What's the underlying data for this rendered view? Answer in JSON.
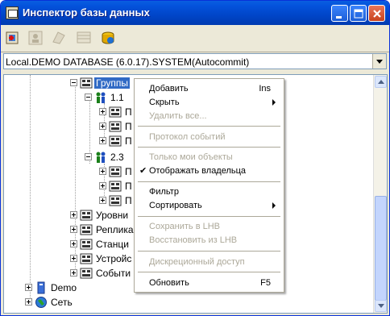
{
  "window": {
    "title": "Инспектор базы данных"
  },
  "toolbar": {
    "buttons": [
      {
        "icon": "add-object-icon",
        "enabled": true
      },
      {
        "icon": "user-icon",
        "enabled": false
      },
      {
        "icon": "documents-icon",
        "enabled": false
      },
      {
        "icon": "table-icon",
        "enabled": false
      },
      {
        "icon": "database-connect-icon",
        "enabled": true
      }
    ]
  },
  "connection": {
    "value": "Local.DEMO DATABASE (6.0.17).SYSTEM(Autocommit)"
  },
  "tree": {
    "groups": "Группы",
    "group1": "1.1",
    "group2": "2.3",
    "child": "П",
    "levels": "Уровни",
    "replic": "Реплика",
    "stations": "Станци",
    "devices": "Устройс",
    "events": "Событи",
    "demo": "Demo",
    "network": "Сеть"
  },
  "menu": {
    "items": [
      {
        "label": "Добавить",
        "shortcut": "Ins",
        "enabled": true
      },
      {
        "label": "Скрыть",
        "enabled": true,
        "submenu": true
      },
      {
        "label": "Удалить все...",
        "enabled": false
      },
      {
        "label": "Протокол событий",
        "enabled": false
      },
      {
        "label": "Только мои объекты",
        "enabled": false
      },
      {
        "label": "Отображать владельца",
        "enabled": true,
        "checked": true
      },
      {
        "label": "Фильтр",
        "enabled": true
      },
      {
        "label": "Сортировать",
        "enabled": true,
        "submenu": true
      },
      {
        "label": "Сохранить в LHB",
        "enabled": false
      },
      {
        "label": "Восстановить из LHB",
        "enabled": false
      },
      {
        "label": "Дискреционный доступ",
        "enabled": false
      },
      {
        "label": "Обновить",
        "shortcut": "F5",
        "enabled": true
      }
    ],
    "check_mark": "✔"
  },
  "colors": {
    "titlebar": "#0453dc",
    "selection": "#316ac5",
    "disabled_text": "#aca899"
  }
}
